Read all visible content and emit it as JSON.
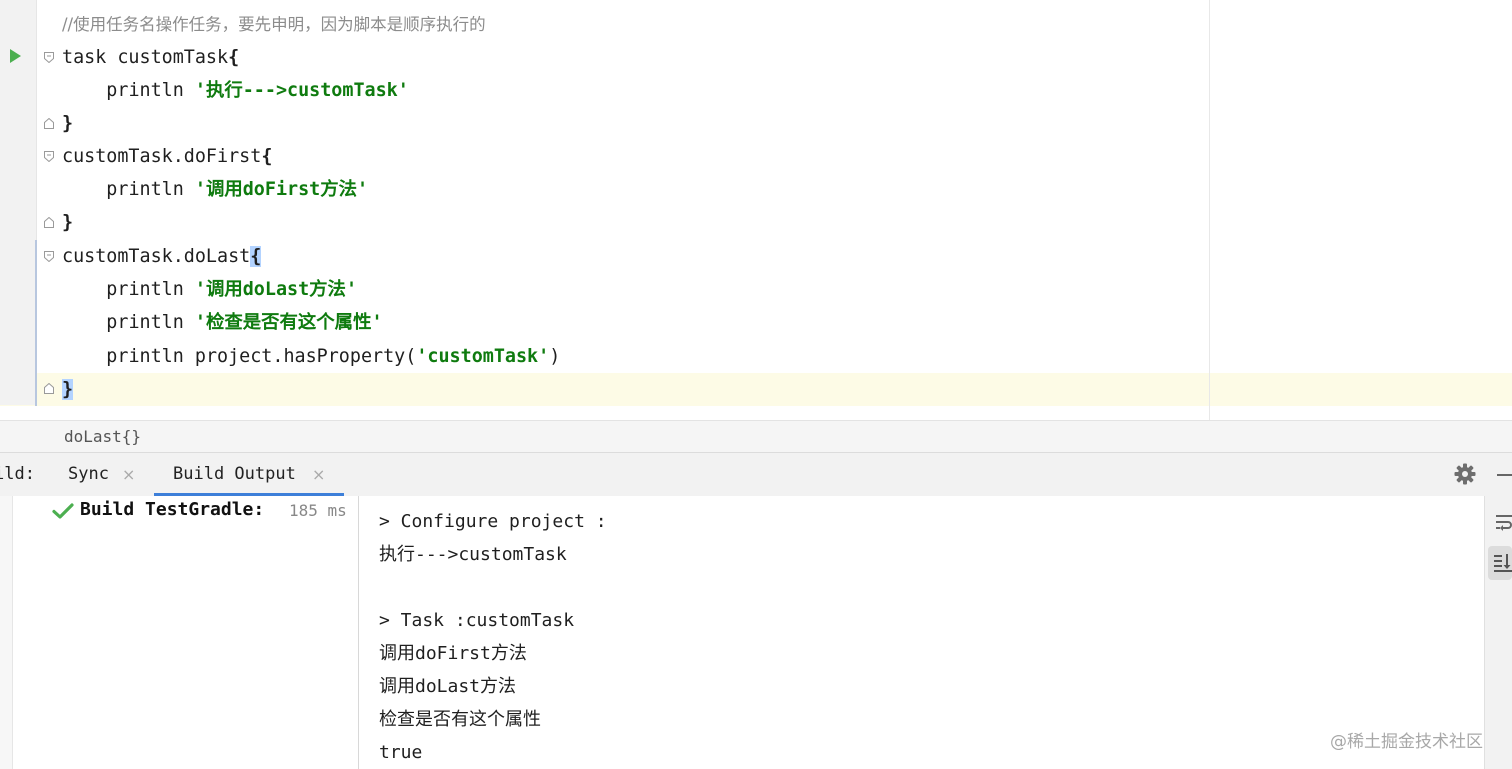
{
  "editor": {
    "lines": [
      {
        "comment": "//使用任务名操作任务，要先申明，因为脚本是顺序执行的"
      },
      {
        "kw": "task customTask",
        "brace": "{"
      },
      {
        "indent": "    ",
        "kw": "println ",
        "str": "'执行--->customTask'"
      },
      {
        "brace": "}"
      },
      {
        "kw": "customTask.doFirst",
        "brace": "{"
      },
      {
        "indent": "    ",
        "kw": "println ",
        "str": "'调用doFirst方法'"
      },
      {
        "brace": "}"
      },
      {
        "kw": "customTask.doLast",
        "brace": "{"
      },
      {
        "indent": "    ",
        "kw": "println ",
        "str": "'调用doLast方法'"
      },
      {
        "indent": "    ",
        "kw": "println ",
        "str": "'检查是否有这个属性'"
      },
      {
        "indent": "    ",
        "kw": "println project.hasProperty(",
        "str": "'customTask'",
        "tail": ")"
      },
      {
        "brace": "}"
      }
    ]
  },
  "breadcrumb": "doLast{}",
  "build_window": {
    "title": "ild:",
    "tabs": [
      {
        "label": "Sync",
        "close": "×"
      },
      {
        "label": "Build Output",
        "close": "×"
      }
    ],
    "active_tab": "Build Output"
  },
  "tree": {
    "label": "Build TestGradle:",
    "time": "185 ms",
    "status_color": "#4caf50"
  },
  "console": {
    "lines": [
      "> Configure project :",
      "执行--->customTask",
      "",
      "> Task :customTask",
      "调用doFirst方法",
      "调用doLast方法",
      "检查是否有这个属性",
      "true"
    ]
  },
  "watermark": "@稀土掘金技术社区",
  "colors": {
    "string": "#0f7b0f",
    "comment": "#8c8c8c",
    "accent": "#3d7fd9",
    "caret_line": "#fdfbe6",
    "brace_highlight": "#b3d3ff"
  }
}
